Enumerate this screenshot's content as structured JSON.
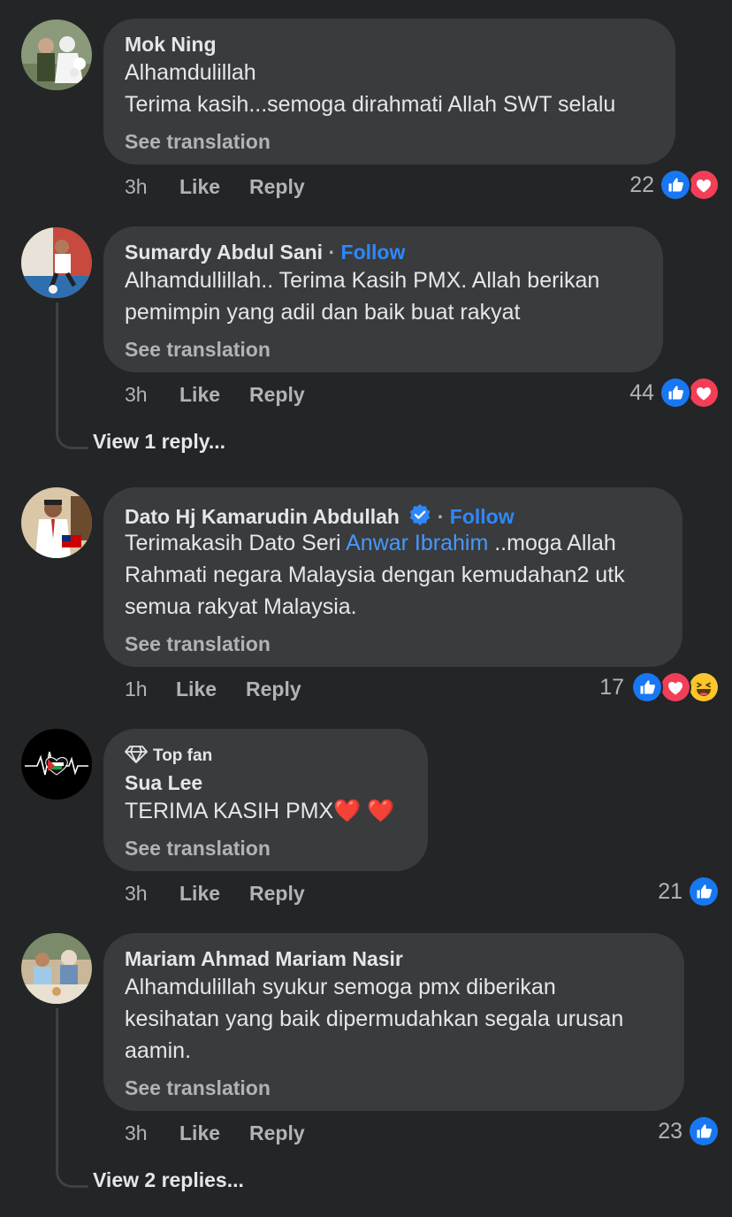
{
  "comments": [
    {
      "name": "Mok Ning",
      "lines": [
        "Alhamdulillah",
        "Terima kasih...semoga dirahmati Allah SWT selalu"
      ],
      "see_translation": "See translation",
      "time": "3h",
      "like": "Like",
      "reply": "Reply",
      "reaction_count": "22",
      "reactions": [
        "like-icon",
        "love-icon"
      ]
    },
    {
      "name": "Sumardy Abdul Sani",
      "separator": "·",
      "follow": "Follow",
      "lines": [
        "Alhamdullillah.. Terima Kasih  PMX. Allah berikan",
        "pemimpin yang adil dan baik buat rakyat"
      ],
      "see_translation": "See translation",
      "time": "3h",
      "like": "Like",
      "reply": "Reply",
      "reaction_count": "44",
      "reactions": [
        "like-icon",
        "love-icon"
      ],
      "view_replies": "View 1 reply..."
    },
    {
      "name": "Dato Hj Kamarudin Abdullah",
      "verified": true,
      "separator": "·",
      "follow": "Follow",
      "line1_before": "Terimakasih Dato Seri ",
      "mention": "Anwar Ibrahim",
      "line1_after": " ..moga Allah",
      "lines": [
        "Rahmati negara Malaysia dengan kemudahan2 utk",
        "semua rakyat Malaysia."
      ],
      "see_translation": "See translation",
      "time": "1h",
      "like": "Like",
      "reply": "Reply",
      "reaction_count": "17",
      "reactions": [
        "like-icon",
        "love-icon",
        "haha-icon"
      ]
    },
    {
      "badge": "Top fan",
      "name": "Sua Lee",
      "text": "TERIMA KASIH PMX",
      "emoji": "❤️ ❤️",
      "see_translation": "See translation",
      "time": "3h",
      "like": "Like",
      "reply": "Reply",
      "reaction_count": "21",
      "reactions": [
        "like-icon"
      ]
    },
    {
      "name": "Mariam Ahmad Mariam Nasir",
      "lines": [
        "Alhamdulillah syukur semoga pmx diberikan",
        "kesihatan yang baik dipermudahkan segala urusan",
        "aamin."
      ],
      "see_translation": "See translation",
      "time": "3h",
      "like": "Like",
      "reply": "Reply",
      "reaction_count": "23",
      "reactions": [
        "like-icon"
      ],
      "view_replies": "View 2 replies..."
    }
  ],
  "colors": {
    "background": "#242526",
    "bubble": "#3a3b3c",
    "link": "#2d88ff",
    "like": "#1877f2",
    "love": "#f33e58"
  }
}
